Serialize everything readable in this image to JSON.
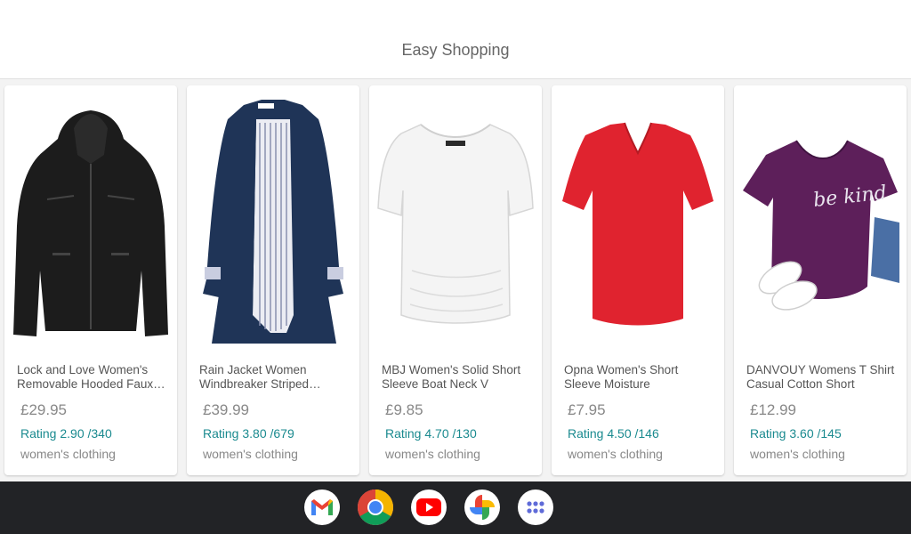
{
  "app": {
    "title": "Easy Shopping"
  },
  "products": [
    {
      "name": "Lock and Love Women's Removable Hooded Faux Leather Jacket",
      "price": "£29.95",
      "rating": "Rating 2.90 /340",
      "category": "women's clothing",
      "image": "black-leather-jacket",
      "color": "#1c1c1c"
    },
    {
      "name": "Rain Jacket Women Windbreaker Striped Climbing Raincoats",
      "price": "£39.99",
      "rating": "Rating 3.80 /679",
      "category": "women's clothing",
      "image": "navy-rain-jacket",
      "color": "#1f3457"
    },
    {
      "name": "MBJ Women's Solid Short Sleeve Boat Neck V",
      "price": "£9.85",
      "rating": "Rating 4.70 /130",
      "category": "women's clothing",
      "image": "white-top",
      "color": "#f4f4f4"
    },
    {
      "name": "Opna Women's Short Sleeve Moisture",
      "price": "£7.95",
      "rating": "Rating 4.50 /146",
      "category": "women's clothing",
      "image": "red-tshirt",
      "color": "#e0232f"
    },
    {
      "name": "DANVOUY Womens T Shirt Casual Cotton Short",
      "price": "£12.99",
      "rating": "Rating 3.60 /145",
      "category": "women's clothing",
      "image": "purple-be-kind-tshirt",
      "color": "#5d1f5a",
      "print": "be kind"
    }
  ],
  "shelf": {
    "apps": [
      {
        "name": "Gmail",
        "icon": "gmail-icon"
      },
      {
        "name": "Chrome",
        "icon": "chrome-icon"
      },
      {
        "name": "YouTube",
        "icon": "youtube-icon"
      },
      {
        "name": "Photos",
        "icon": "photos-icon"
      },
      {
        "name": "Launcher",
        "icon": "app-launcher-icon"
      }
    ]
  }
}
